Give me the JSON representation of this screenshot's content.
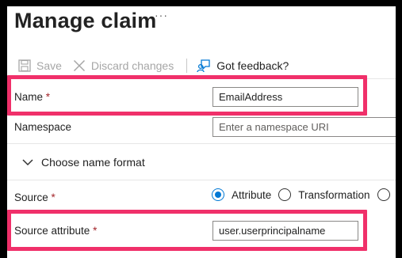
{
  "page": {
    "title": "Manage claim",
    "more_label": "···"
  },
  "toolbar": {
    "save_label": "Save",
    "discard_label": "Discard changes",
    "feedback_label": "Got feedback?"
  },
  "form": {
    "name": {
      "label": "Name",
      "required_mark": "*",
      "value": "EmailAddress"
    },
    "namespace": {
      "label": "Namespace",
      "placeholder": "Enter a namespace URI"
    },
    "name_format": {
      "label": "Choose name format"
    },
    "source": {
      "label": "Source",
      "required_mark": "*",
      "options": [
        "Attribute",
        "Transformation"
      ],
      "selected": "Attribute"
    },
    "source_attribute": {
      "label": "Source attribute",
      "required_mark": "*",
      "value": "user.userprincipalname"
    }
  },
  "colors": {
    "highlight": "#f0306a",
    "accent": "#0078d4",
    "required": "#a4262c"
  }
}
